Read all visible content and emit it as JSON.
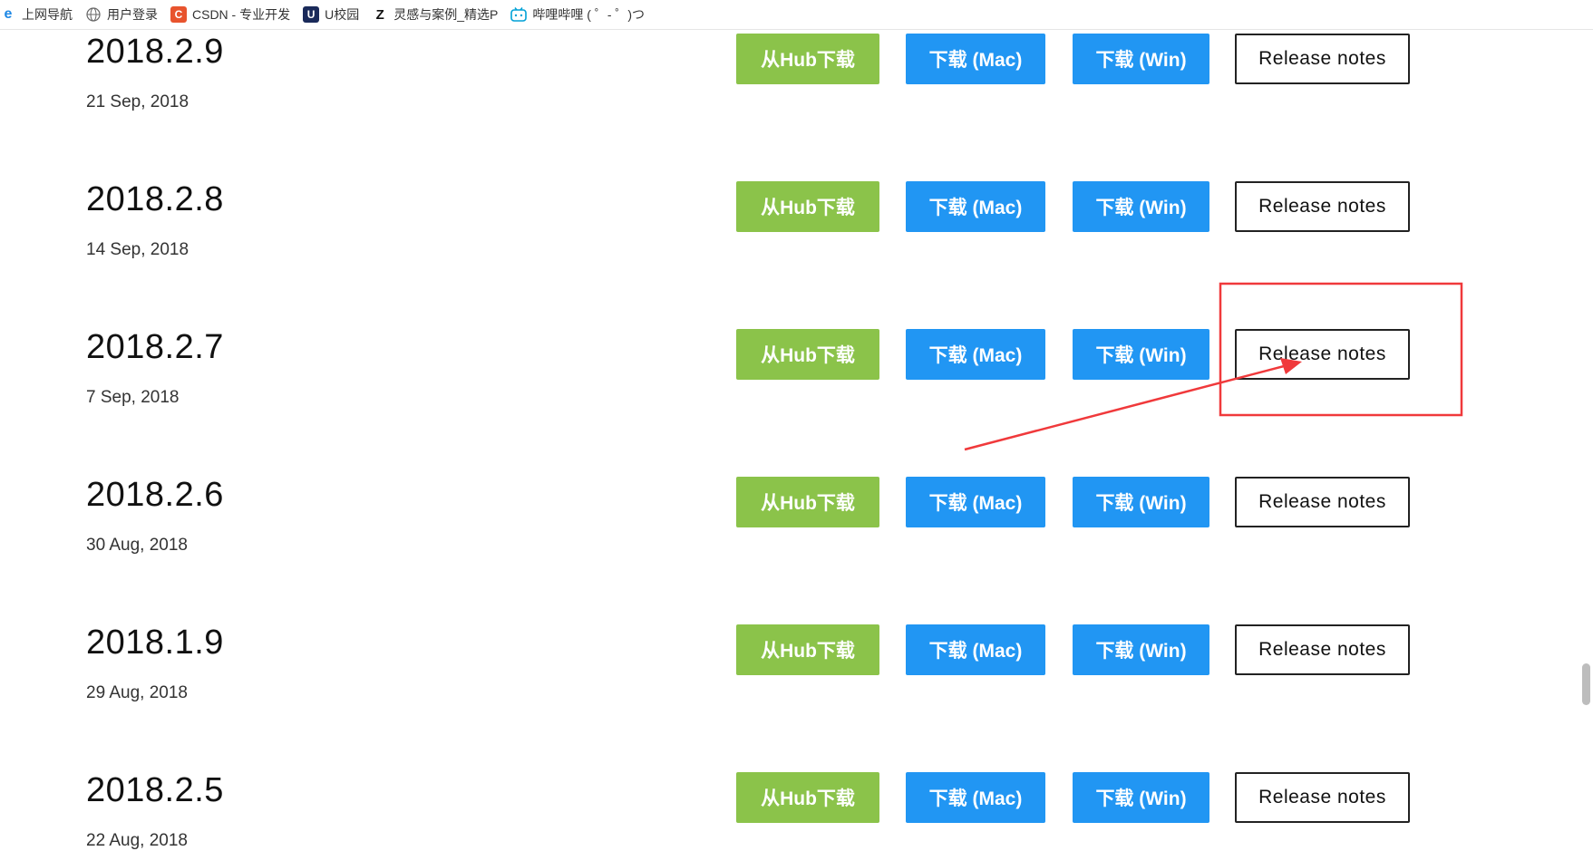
{
  "bookmarks": [
    {
      "icon": "ie-icon",
      "label": "上网导航"
    },
    {
      "icon": "globe-icon",
      "label": "用户登录"
    },
    {
      "icon": "csdn-icon",
      "label": "CSDN - 专业开发"
    },
    {
      "icon": "u-icon",
      "label": "U校园"
    },
    {
      "icon": "zcool-icon",
      "label": "灵感与案例_精选P"
    },
    {
      "icon": "bilibili-icon",
      "label": "哔哩哔哩 ( ゜- ゜)つ"
    }
  ],
  "buttons": {
    "hub": "从Hub下载",
    "mac": "下载 (Mac)",
    "win": "下载 (Win)",
    "notes": "Release notes"
  },
  "releases": [
    {
      "version": "2018.2.9",
      "date": "21 Sep, 2018"
    },
    {
      "version": "2018.2.8",
      "date": "14 Sep, 2018"
    },
    {
      "version": "2018.2.7",
      "date": "7 Sep, 2018"
    },
    {
      "version": "2018.2.6",
      "date": "30 Aug, 2018"
    },
    {
      "version": "2018.1.9",
      "date": "29 Aug, 2018"
    },
    {
      "version": "2018.2.5",
      "date": "22 Aug, 2018"
    }
  ],
  "colors": {
    "hub_green": "#8bc34a",
    "download_blue": "#2196f3",
    "annotation_red": "#f0393b"
  }
}
